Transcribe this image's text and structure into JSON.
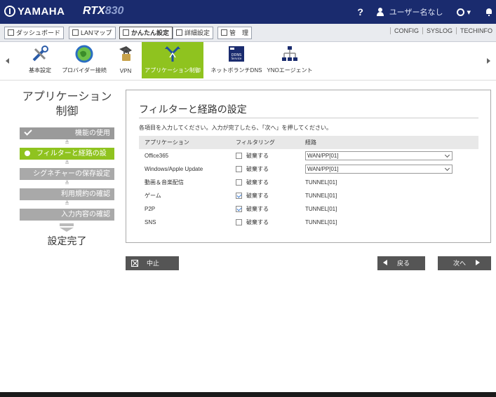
{
  "header": {
    "brand": "YAMAHA",
    "model_main": "RTX",
    "model_num": "830",
    "help": "?",
    "username": "ユーザー名なし",
    "circle_dd": "▾"
  },
  "menubar": {
    "buttons": [
      {
        "label": "ダッシュボード"
      },
      {
        "label": "LANマップ"
      },
      {
        "label": "かんたん設定"
      },
      {
        "label": "詳細設定"
      },
      {
        "label": "管　理"
      }
    ],
    "links": [
      "CONFIG",
      "SYSLOG",
      "TECHINFO"
    ]
  },
  "icons": [
    {
      "label": "基本設定",
      "icon": "tools-icon"
    },
    {
      "label": "プロバイダー接続",
      "icon": "globe-icon"
    },
    {
      "label": "VPN",
      "icon": "vpn-icon"
    },
    {
      "label": "アプリケーション制御",
      "icon": "app-control-icon"
    },
    {
      "label": "ネットボランチDNS",
      "icon": "ddns-icon"
    },
    {
      "label": "YNOエージェント",
      "icon": "network-icon"
    }
  ],
  "ddns_icon_text": "DDNS\nService",
  "sidebar": {
    "title_line1": "アプリケーション",
    "title_line2": "制御",
    "steps": [
      {
        "label": "機能の使用",
        "state": "done"
      },
      {
        "label": "フィルターと経路の設定",
        "state": "current"
      },
      {
        "label": "シグネチャーの保存設定",
        "state": "todo"
      },
      {
        "label": "利用規約の確認",
        "state": "todo"
      },
      {
        "label": "入力内容の確認",
        "state": "todo"
      }
    ],
    "chevron": "≚",
    "done": "設定完了"
  },
  "panel": {
    "title": "フィルターと経路の設定",
    "desc": "各項目を入力してください。入力が完了したら、「次へ」を押してください。",
    "columns": [
      "アプリケーション",
      "フィルタリング",
      "経路"
    ],
    "rows": [
      {
        "app": "Office365",
        "filter_label": "破棄する",
        "checked": false,
        "route": "WAN/PP[01]",
        "select": true
      },
      {
        "app": "Windows/Apple Update",
        "filter_label": "破棄する",
        "checked": false,
        "route": "WAN/PP[01]",
        "select": true
      },
      {
        "app": "動画＆音楽配信",
        "filter_label": "破棄する",
        "checked": false,
        "route": "TUNNEL[01]",
        "select": false
      },
      {
        "app": "ゲーム",
        "filter_label": "破棄する",
        "checked": true,
        "route": "TUNNEL[01]",
        "select": false
      },
      {
        "app": "P2P",
        "filter_label": "破棄する",
        "checked": true,
        "route": "TUNNEL[01]",
        "select": false
      },
      {
        "app": "SNS",
        "filter_label": "破棄する",
        "checked": false,
        "route": "TUNNEL[01]",
        "select": false
      }
    ]
  },
  "buttons": {
    "cancel": "中止",
    "back": "戻る",
    "next": "次へ"
  },
  "colors": {
    "header_bg": "#1a2b6e",
    "accent_green": "#8fc31f",
    "button_gray": "#555555"
  }
}
